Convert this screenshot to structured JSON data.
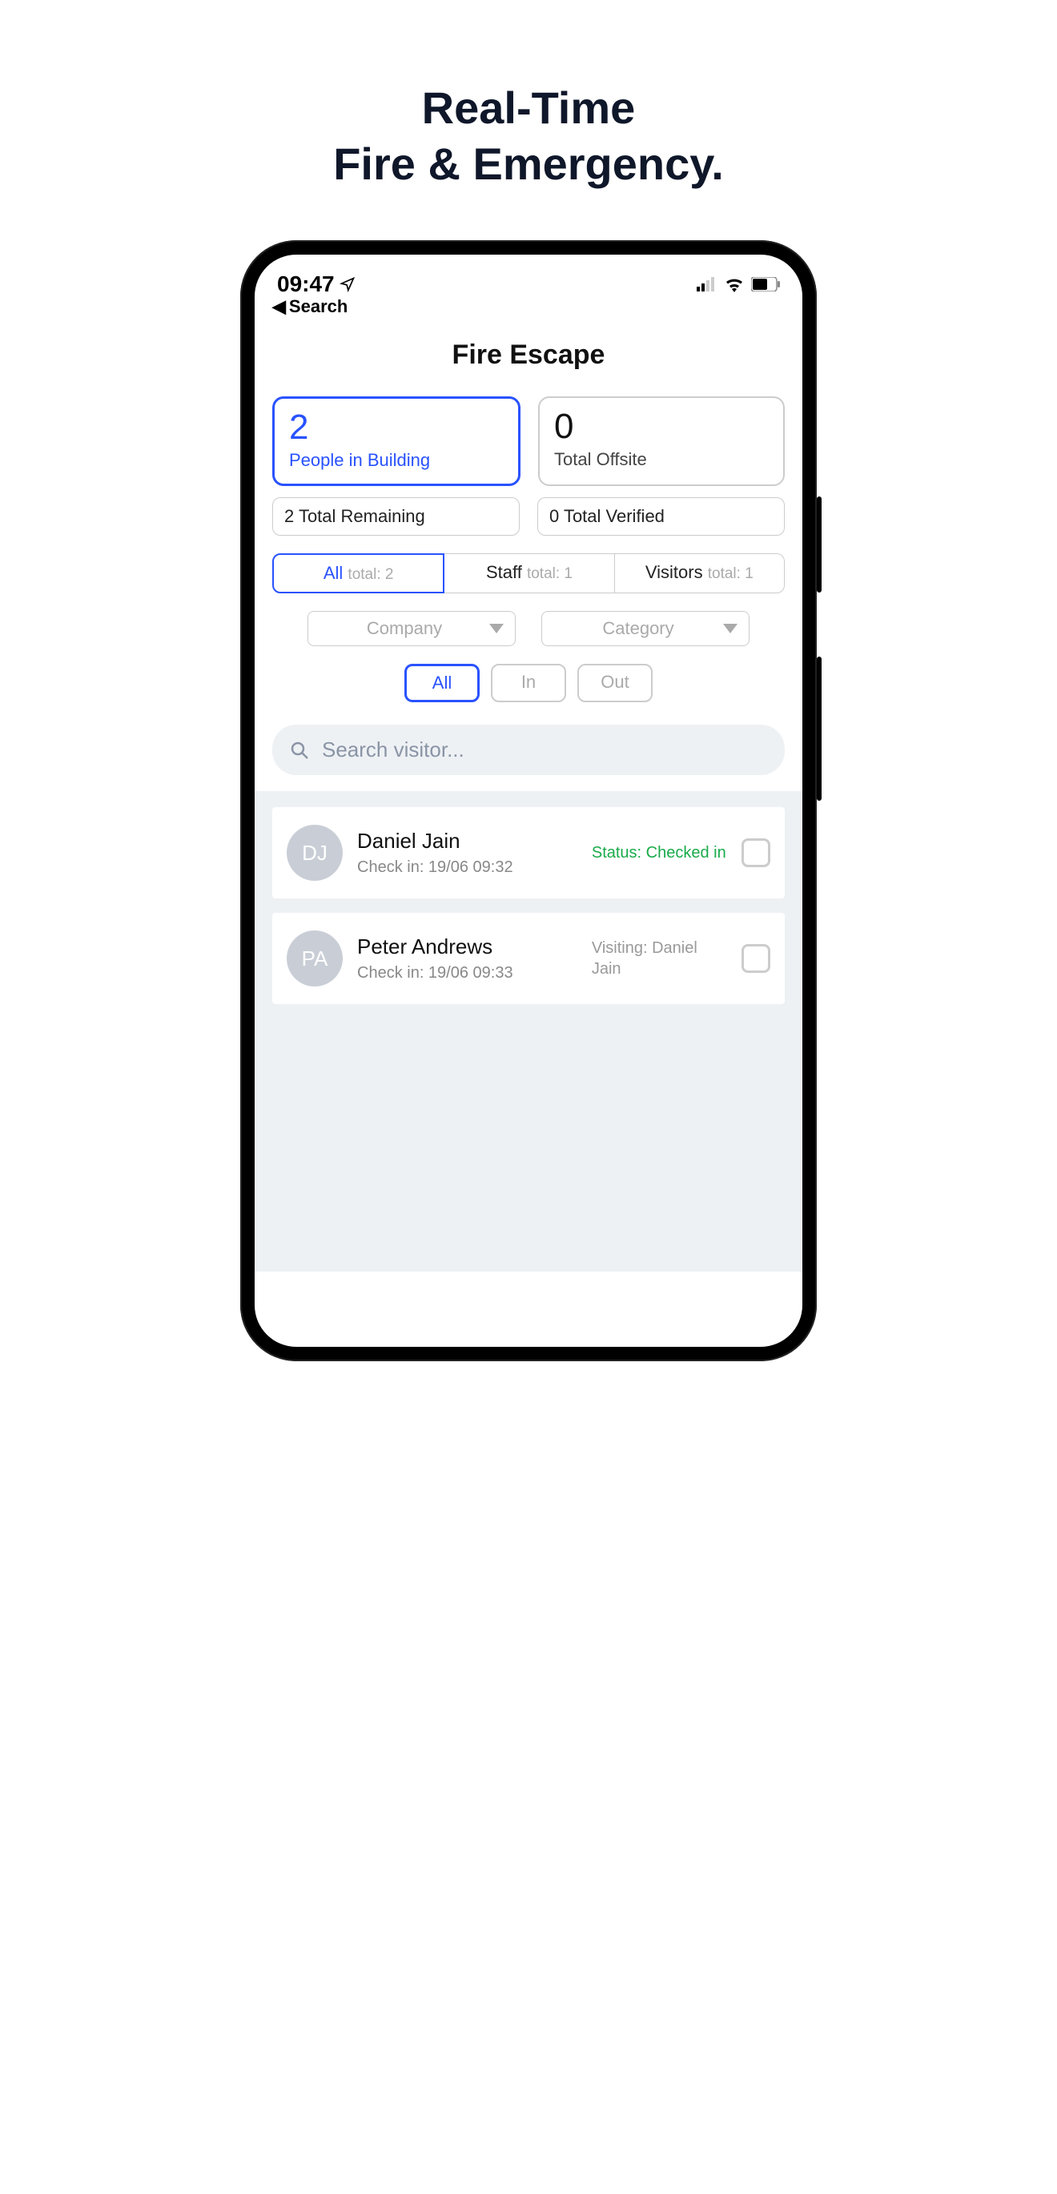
{
  "marketing_title": "Real-Time\nFire & Emergency.",
  "status_bar": {
    "time": "09:47",
    "back_label": "Search"
  },
  "app": {
    "title": "Fire Escape",
    "stats": [
      {
        "value": "2",
        "label": "People in Building",
        "active": true
      },
      {
        "value": "0",
        "label": "Total Offsite",
        "active": false
      }
    ],
    "counts": [
      {
        "text": "2 Total Remaining"
      },
      {
        "text": "0 Total Verified"
      }
    ],
    "segments": [
      {
        "label": "All",
        "sub": "total: 2",
        "active": true
      },
      {
        "label": "Staff",
        "sub": "total: 1",
        "active": false
      },
      {
        "label": "Visitors",
        "sub": "total: 1",
        "active": false
      }
    ],
    "dropdowns": [
      {
        "label": "Company"
      },
      {
        "label": "Category"
      }
    ],
    "pills": [
      {
        "label": "All",
        "active": true
      },
      {
        "label": "In",
        "active": false
      },
      {
        "label": "Out",
        "active": false
      }
    ],
    "search_placeholder": "Search visitor...",
    "people": [
      {
        "initials": "DJ",
        "name": "Daniel Jain",
        "checkin": "Check in: 19/06 09:32",
        "status": "Status: Checked in",
        "status_class": "green"
      },
      {
        "initials": "PA",
        "name": "Peter Andrews",
        "checkin": "Check in: 19/06 09:33",
        "status": "Visiting: Daniel Jain",
        "status_class": "grey"
      }
    ]
  }
}
